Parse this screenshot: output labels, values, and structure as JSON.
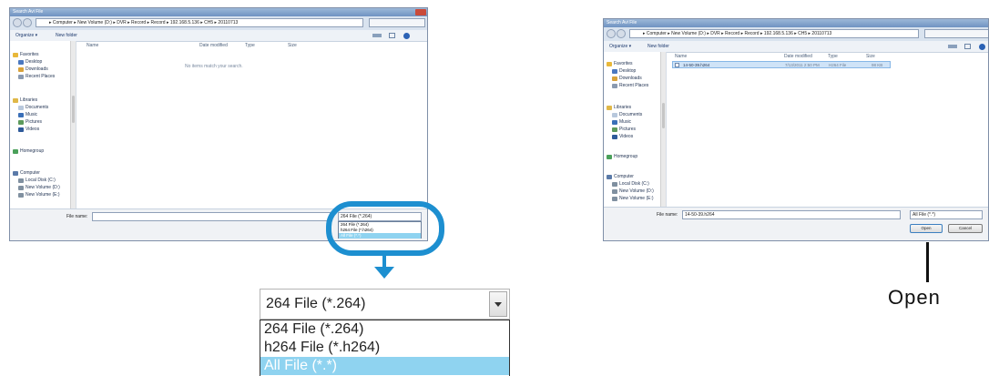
{
  "left_dialog": {
    "title": "Search Avi File",
    "address_path": "▸ Computer ▸ New Volume (D:) ▸ DVR ▸ Record ▸ Record ▸ 192.168.5.136 ▸ CH5 ▸ 20110713",
    "toolbar": {
      "organize": "Organize ▾",
      "new_folder": "New folder"
    },
    "columns": [
      "Name",
      "Date modified",
      "Type",
      "Size"
    ],
    "empty_message": "No items match your search.",
    "nav_items": [
      "Favorites",
      "Desktop",
      "Downloads",
      "Recent Places",
      "Libraries",
      "Documents",
      "Music",
      "Pictures",
      "Videos",
      "Homegroup",
      "Computer",
      "Local Disk (C:)",
      "New Volume (D:)",
      "New Volume (E:)"
    ],
    "file_name_label": "File name:",
    "file_name_value": "",
    "filter_selected": "264 File (*.264)",
    "filter_options": [
      "264 File (*.264)",
      "h264 File (*.h264)",
      "All File (*.*)"
    ]
  },
  "zoom_callout": {
    "selected": "264 File (*.264)",
    "options": [
      "264 File (*.264)",
      "h264 File (*.h264)",
      "All File (*.*)"
    ],
    "highlighted_index": 2,
    "highlight_color": "#8fd3f0",
    "accent_color": "#1d8fd0"
  },
  "right_dialog": {
    "title": "Search Avi File",
    "address_path": "▸ Computer ▸ New Volume (D:) ▸ DVR ▸ Record ▸ Record ▸ 192.168.5.136 ▸ CH5 ▸ 20110713",
    "toolbar": {
      "organize": "Organize ▾",
      "new_folder": "New folder"
    },
    "columns": [
      "Name",
      "Date modified",
      "Type",
      "Size"
    ],
    "file_row": {
      "name": "14-50-39.h264",
      "date": "7/13/2011 2:50 PM",
      "type": "H264 File",
      "size": "98 KB"
    },
    "nav_items": [
      "Favorites",
      "Desktop",
      "Downloads",
      "Recent Places",
      "Libraries",
      "Documents",
      "Music",
      "Pictures",
      "Videos",
      "Homegroup",
      "Computer",
      "Local Disk (C:)",
      "New Volume (D:)",
      "New Volume (E:)"
    ],
    "file_name_label": "File name:",
    "file_name_value": "14-50-39.h264",
    "filter_selected": "All File (*.*)",
    "open_button": "Open",
    "cancel_button": "Cancel"
  },
  "annotation": {
    "open_label": "Open"
  }
}
